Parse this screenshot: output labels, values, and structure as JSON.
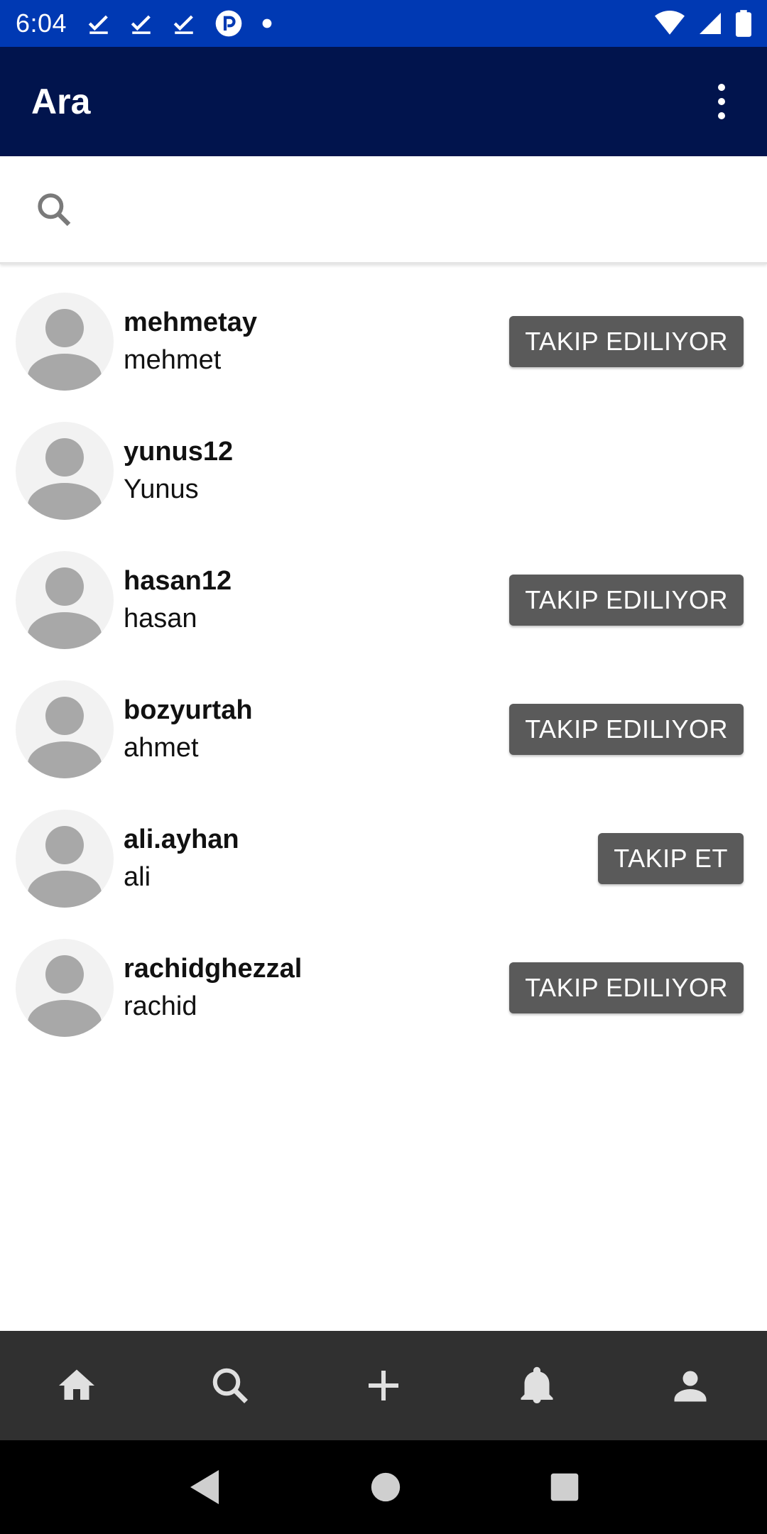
{
  "status_bar": {
    "time": "6:04",
    "icons_left": [
      "check-icon",
      "check-icon",
      "check-icon",
      "app-badge-icon",
      "dot-icon"
    ],
    "icons_right": [
      "wifi-icon",
      "signal-icon",
      "battery-icon"
    ]
  },
  "app_bar": {
    "title": "Ara",
    "menu_icon": "more-vert-icon"
  },
  "search": {
    "icon": "search-icon",
    "value": "",
    "placeholder": ""
  },
  "users": [
    {
      "username": "mehmetay",
      "name": "mehmet",
      "button": "TAKIP EDILIYOR"
    },
    {
      "username": "yunus12",
      "name": "Yunus",
      "button": ""
    },
    {
      "username": "hasan12",
      "name": "hasan",
      "button": "TAKIP EDILIYOR"
    },
    {
      "username": "bozyurtah",
      "name": "ahmet",
      "button": "TAKIP EDILIYOR"
    },
    {
      "username": "ali.ayhan",
      "name": "ali",
      "button": "TAKIP ET"
    },
    {
      "username": "rachidghezzal",
      "name": "rachid",
      "button": "TAKIP EDILIYOR"
    }
  ],
  "bottom_nav": {
    "items": [
      "home-icon",
      "search-icon",
      "add-icon",
      "notifications-icon",
      "profile-icon"
    ]
  },
  "system_nav": {
    "items": [
      "back-icon",
      "home-circle-icon",
      "recents-icon"
    ]
  },
  "colors": {
    "status_bar": "#0039b3",
    "app_bar": "#01144d",
    "button": "#5a5a5a",
    "bottom_nav": "#303030",
    "avatar_bg": "#f2f2f2",
    "avatar_fg": "#a8a8a8"
  }
}
